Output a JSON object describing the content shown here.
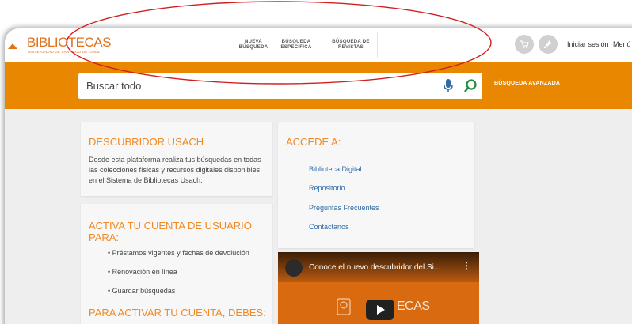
{
  "header": {
    "logo_text": "BIBLIOTECAS",
    "logo_subtext": "UNIVERSIDAD DE SANTIAGO DE CHILE",
    "nav": [
      {
        "line1": "NUEVA",
        "line2": "BÚSQUEDA"
      },
      {
        "line1": "BÚSQUEDA",
        "line2": "ESPECÍFICA"
      },
      {
        "line1": "BÚSQUEDA DE",
        "line2": "REVISTAS"
      }
    ],
    "icons": [
      "cart-icon",
      "pin-icon"
    ],
    "signin_label": "Iniciar sesión",
    "menu_label": "Menú"
  },
  "search": {
    "placeholder": "Buscar todo",
    "advanced_label": "BÚSQUEDA AVANZADA"
  },
  "cards": {
    "descubridor": {
      "title": "DESCUBRIDOR USACH",
      "lines": [
        "Desde esta plataforma realiza tus búsquedas en todas",
        "las colecciones físicas y recursos digitales disponibles",
        "en el Sistema de Bibliotecas Usach."
      ]
    },
    "accede": {
      "title": "ACCEDE A:",
      "links": [
        "Biblioteca Digital",
        "Repositorio",
        "Preguntas Frecuentes",
        "Contáctanos"
      ]
    },
    "activa": {
      "title": "ACTIVA TU CUENTA DE USUARIO PARA:",
      "bullets": [
        "• Préstamos vigentes y fechas de devolución",
        "• Renovación en línea",
        "• Guardar búsquedas"
      ],
      "subtitle": "PARA ACTIVAR TU CUENTA, DEBES:"
    }
  },
  "video": {
    "title": "Conoce el nuevo descubridor del Si...",
    "logo_text": "ECAS"
  },
  "colors": {
    "accent": "#e98700",
    "title_orange": "#ef8a24",
    "link_blue": "#2e6aa8",
    "annotation_red": "#d21f1f"
  }
}
